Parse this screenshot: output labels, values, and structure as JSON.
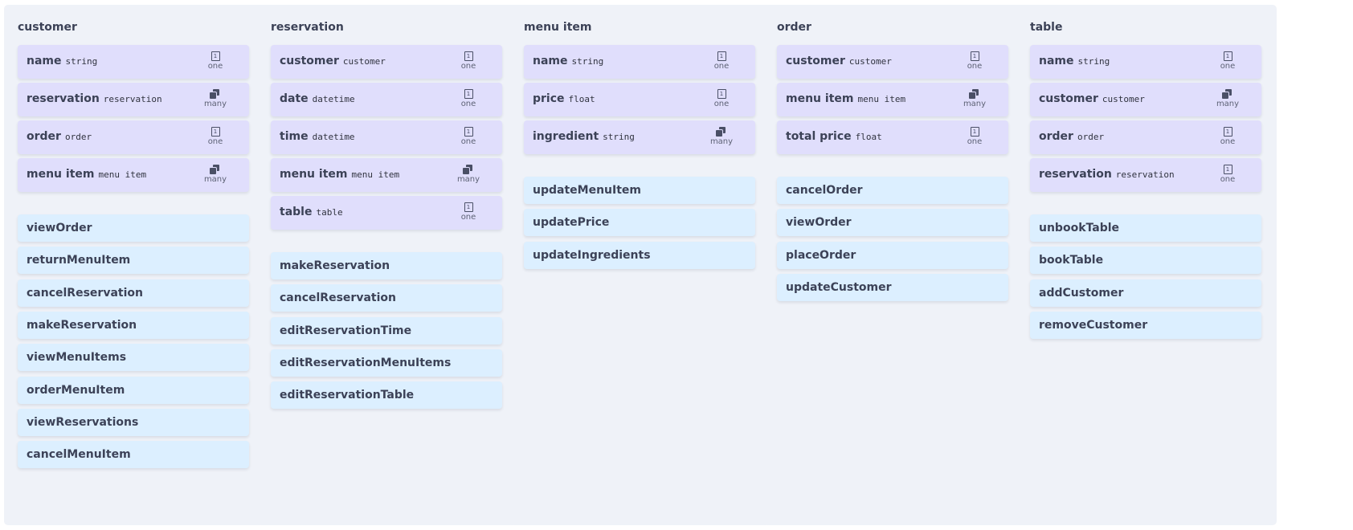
{
  "entities": [
    {
      "title": "customer",
      "attributes": [
        {
          "name": "name",
          "type": "string",
          "multiplicity": "one",
          "one_glyph": "1"
        },
        {
          "name": "reservation",
          "type": "reservation",
          "multiplicity": "many"
        },
        {
          "name": "order",
          "type": "order",
          "multiplicity": "one",
          "one_glyph": "1"
        },
        {
          "name": "menu item",
          "type": "menu item",
          "multiplicity": "many"
        }
      ],
      "methods": [
        "viewOrder",
        "returnMenuItem",
        "cancelReservation",
        "makeReservation",
        "viewMenuItems",
        "orderMenuItem",
        "viewReservations",
        "cancelMenuItem"
      ]
    },
    {
      "title": "reservation",
      "attributes": [
        {
          "name": "customer",
          "type": "customer",
          "multiplicity": "one",
          "one_glyph": "1"
        },
        {
          "name": "date",
          "type": "datetime",
          "multiplicity": "one",
          "one_glyph": "1"
        },
        {
          "name": "time",
          "type": "datetime",
          "multiplicity": "one",
          "one_glyph": "1"
        },
        {
          "name": "menu item",
          "type": "menu item",
          "multiplicity": "many"
        },
        {
          "name": "table",
          "type": "table",
          "multiplicity": "one",
          "one_glyph": "1"
        }
      ],
      "methods": [
        "makeReservation",
        "cancelReservation",
        "editReservationTime",
        "editReservationMenuItems",
        "editReservationTable"
      ]
    },
    {
      "title": "menu item",
      "attributes": [
        {
          "name": "name",
          "type": "string",
          "multiplicity": "one",
          "one_glyph": "1"
        },
        {
          "name": "price",
          "type": "float",
          "multiplicity": "one",
          "one_glyph": "1"
        },
        {
          "name": "ingredient",
          "type": "string",
          "multiplicity": "many"
        }
      ],
      "methods": [
        "updateMenuItem",
        "updatePrice",
        "updateIngredients"
      ]
    },
    {
      "title": "order",
      "attributes": [
        {
          "name": "customer",
          "type": "customer",
          "multiplicity": "one",
          "one_glyph": "1"
        },
        {
          "name": "menu item",
          "type": "menu item",
          "multiplicity": "many"
        },
        {
          "name": "total price",
          "type": "float",
          "multiplicity": "one",
          "one_glyph": "1"
        }
      ],
      "methods": [
        "cancelOrder",
        "viewOrder",
        "placeOrder",
        "updateCustomer"
      ]
    },
    {
      "title": "table",
      "attributes": [
        {
          "name": "name",
          "type": "string",
          "multiplicity": "one",
          "one_glyph": "1"
        },
        {
          "name": "customer",
          "type": "customer",
          "multiplicity": "many"
        },
        {
          "name": "order",
          "type": "order",
          "multiplicity": "one",
          "one_glyph": "1"
        },
        {
          "name": "reservation",
          "type": "reservation",
          "multiplicity": "one",
          "one_glyph": "1"
        }
      ],
      "methods": [
        "unbookTable",
        "bookTable",
        "addCustomer",
        "removeCustomer"
      ]
    }
  ],
  "colors": {
    "panel": "#eff2f8",
    "attribute_card": "#e0defc",
    "method_card": "#dcefff",
    "text": "#3c4257"
  }
}
